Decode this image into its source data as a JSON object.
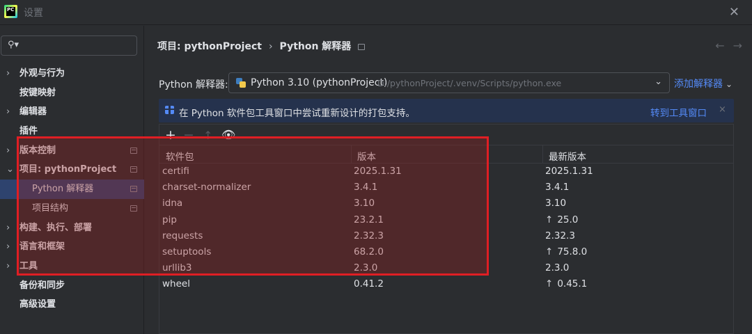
{
  "window": {
    "title": "设置",
    "app_logo_text": "PC"
  },
  "sidebar": {
    "search_placeholder": "",
    "items": [
      {
        "label": "外观与行为",
        "chevron": "›"
      },
      {
        "label": "按键映射",
        "chevron": ""
      },
      {
        "label": "编辑器",
        "chevron": "›"
      },
      {
        "label": "插件",
        "chevron": ""
      },
      {
        "label": "版本控制",
        "chevron": "›"
      },
      {
        "label": "项目: pythonProject",
        "chevron": "⌄"
      },
      {
        "label": "Python 解释器",
        "chevron": ""
      },
      {
        "label": "项目结构",
        "chevron": ""
      },
      {
        "label": "构建、执行、部署",
        "chevron": "›"
      },
      {
        "label": "语言和框架",
        "chevron": "›"
      },
      {
        "label": "工具",
        "chevron": "›"
      },
      {
        "label": "备份和同步",
        "chevron": ""
      },
      {
        "label": "高级设置",
        "chevron": ""
      }
    ]
  },
  "main": {
    "breadcrumb": {
      "parent": "项目: pythonProject",
      "separator": "›",
      "current": "Python 解释器"
    },
    "interpreter": {
      "label": "Python 解释器:",
      "name": "Python 3.10 (pythonProject)",
      "path": "D:/pythonProject/.venv/Scripts/python.exe",
      "add_label": "添加解释器"
    },
    "banner": {
      "text": "在 Python 软件包工具窗口中尝试重新设计的打包支持。",
      "link": "转到工具窗口",
      "close": "×"
    },
    "table": {
      "headers": {
        "package": "软件包",
        "version": "版本",
        "latest": "最新版本"
      },
      "rows": [
        {
          "package": "certifi",
          "version": "2025.1.31",
          "latest": "2025.1.31",
          "upgrade": ""
        },
        {
          "package": "charset-normalizer",
          "version": "3.4.1",
          "latest": "3.4.1",
          "upgrade": ""
        },
        {
          "package": "idna",
          "version": "3.10",
          "latest": "3.10",
          "upgrade": ""
        },
        {
          "package": "pip",
          "version": "23.2.1",
          "latest": "25.0",
          "upgrade": "↑"
        },
        {
          "package": "requests",
          "version": "2.32.3",
          "latest": "2.32.3",
          "upgrade": ""
        },
        {
          "package": "setuptools",
          "version": "68.2.0",
          "latest": "75.8.0",
          "upgrade": "↑"
        },
        {
          "package": "urllib3",
          "version": "2.3.0",
          "latest": "2.3.0",
          "upgrade": ""
        },
        {
          "package": "wheel",
          "version": "0.41.2",
          "latest": "0.45.1",
          "upgrade": "↑"
        }
      ]
    }
  },
  "colors": {
    "accent": "#548af7",
    "selection": "#2e436e",
    "highlight_border": "#e01e24"
  }
}
